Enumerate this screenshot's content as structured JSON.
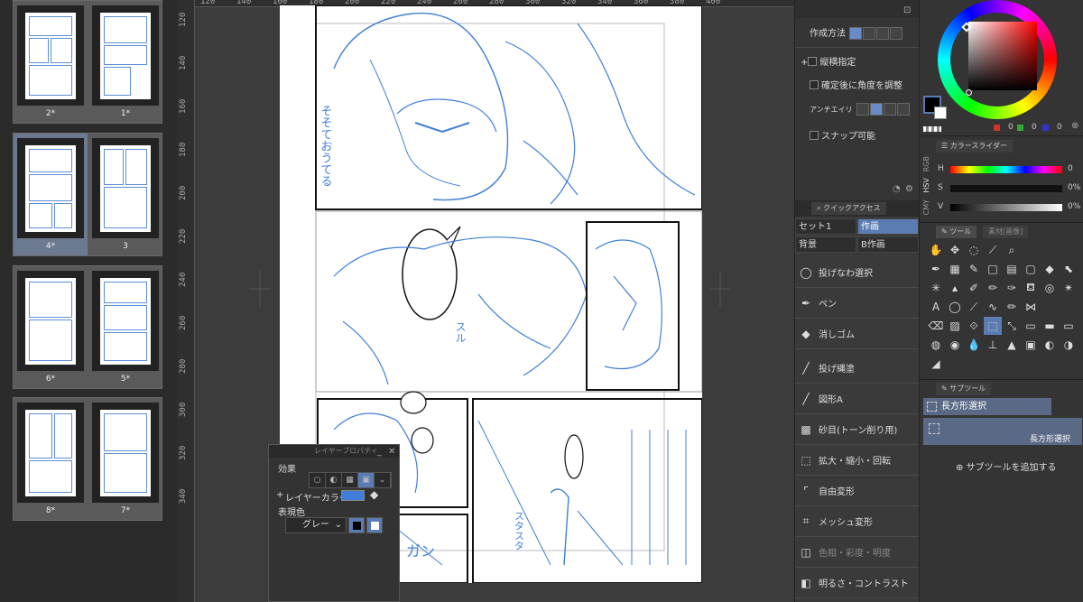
{
  "page_list": {
    "spreads": [
      {
        "left_label": "2*",
        "right_label": "1*",
        "active": false
      },
      {
        "left_label": "4*",
        "right_label": "3",
        "active": true
      },
      {
        "left_label": "6*",
        "right_label": "5*",
        "active": false
      },
      {
        "left_label": "8*",
        "right_label": "7*",
        "active": false
      }
    ]
  },
  "rulers": {
    "top_ticks": [
      "120",
      "140",
      "160",
      "180",
      "200",
      "220",
      "240",
      "260",
      "280",
      "300",
      "320",
      "340",
      "360",
      "380",
      "400"
    ],
    "left_ticks": [
      "120",
      "140",
      "160",
      "180",
      "200",
      "220",
      "240",
      "260",
      "280",
      "300",
      "320",
      "340"
    ]
  },
  "canvas": {
    "sfx_left": "そそておうてる",
    "sfx_mid": "スル",
    "sfx_bottom_right": "スタスタ",
    "sfx_bottom_left": "ガン"
  },
  "layer_property": {
    "title": "レイヤープロパティ",
    "effect_label": "効果",
    "layer_color_label": "レイヤーカラー",
    "layer_color": "#3f7fd9",
    "expression_label": "表現色",
    "expression_value": "グレー"
  },
  "tool_settings": {
    "method_label": "作成方法",
    "aspect_label": "縦横指定",
    "angle_label": "確定後に角度を調整",
    "antialias_label": "アンチエイリ",
    "snap_label": "スナップ可能"
  },
  "quick_access": {
    "title": "クイックアクセス",
    "sets": [
      {
        "label": "セット1",
        "selected": false
      },
      {
        "label": "作画",
        "selected": true
      },
      {
        "label": "背景",
        "selected": false
      },
      {
        "label": "B作画",
        "selected": false
      }
    ],
    "items": [
      {
        "label": "投げなわ選択",
        "icon": "lasso-icon"
      },
      {
        "label": "ペン",
        "icon": "pen-icon"
      },
      {
        "label": "消しゴム",
        "icon": "eraser-icon"
      },
      {
        "label": "投げ縄塗",
        "icon": "lasso-fill-icon"
      },
      {
        "label": "図形A",
        "icon": "line-icon"
      },
      {
        "label": "砂目(トーン削り用)",
        "icon": "sand-texture-icon"
      },
      {
        "label": "拡大・縮小・回転",
        "icon": "transform-icon"
      },
      {
        "label": "自由変形",
        "icon": "free-transform-icon"
      },
      {
        "label": "メッシュ変形",
        "icon": "mesh-transform-icon"
      },
      {
        "label": "色相・彩度・明度",
        "icon": "hsl-icon"
      },
      {
        "label": "明るさ・コントラスト",
        "icon": "contrast-icon"
      }
    ]
  },
  "color": {
    "main_color": "#000000",
    "sub_color": "#ffffff",
    "rgb_values": [
      "0",
      "0",
      "0"
    ]
  },
  "color_slider": {
    "title": "カラースライダー",
    "mode_tabs": [
      "RGB",
      "HSV",
      "CMY"
    ],
    "rows": [
      {
        "label": "H",
        "value": "0"
      },
      {
        "label": "S",
        "value": "0%"
      },
      {
        "label": "V",
        "value": "0%"
      }
    ]
  },
  "tool_panel": {
    "tab_tool": "ツール",
    "tab_other": "素材[画像]"
  },
  "subtool": {
    "tab": "サブツール",
    "header": "長方形選択",
    "selected_item": "長方形選択",
    "add_label": "サブツールを追加する"
  }
}
